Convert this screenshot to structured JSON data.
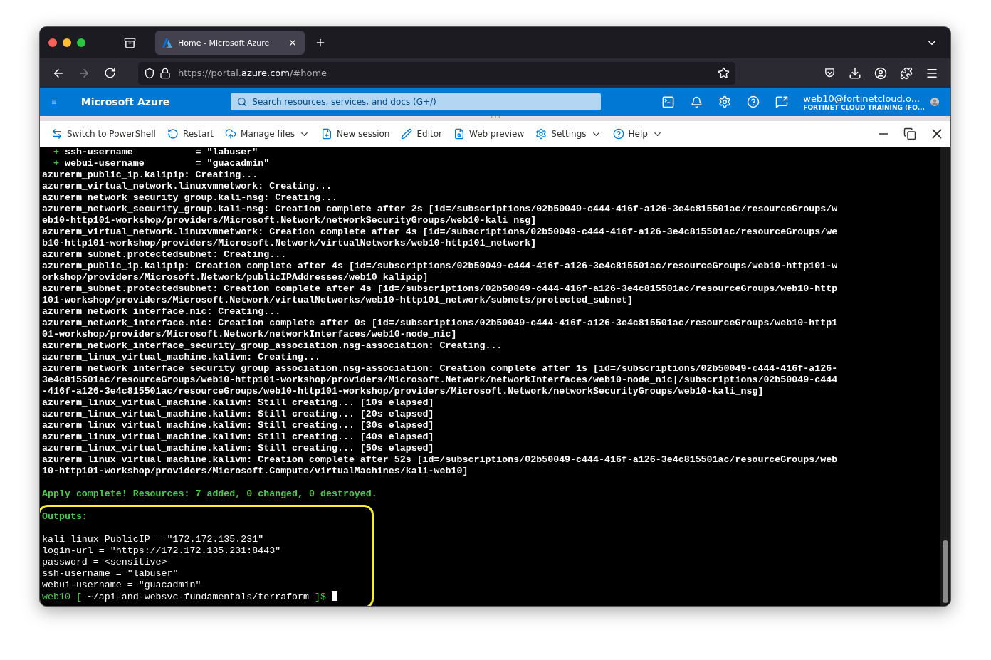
{
  "browser": {
    "tabs": [
      {
        "title": "Home - Microsoft Azure",
        "selected": true
      }
    ],
    "nav": {
      "back_disabled": false,
      "forward_disabled": true
    },
    "url": {
      "prefix": "https://portal.",
      "domain": "azure.com",
      "suffix": "/#home"
    }
  },
  "portal": {
    "brand": "Microsoft Azure",
    "search_placeholder": "Search resources, services, and docs (G+/)",
    "account": {
      "email": "web10@fortinetcloud.o...",
      "tenant": "FORTINET CLOUD TRAINING (FO..."
    }
  },
  "shell_toolbar": {
    "items": [
      {
        "kind": "switch",
        "label": "Switch to PowerShell",
        "dropdown": false
      },
      {
        "kind": "restart",
        "label": "Restart",
        "dropdown": false
      },
      {
        "kind": "files",
        "label": "Manage files",
        "dropdown": true
      },
      {
        "kind": "session",
        "label": "New session",
        "dropdown": false
      },
      {
        "kind": "editor",
        "label": "Editor",
        "dropdown": false
      },
      {
        "kind": "preview",
        "label": "Web preview",
        "dropdown": false
      },
      {
        "kind": "settings",
        "label": "Settings",
        "dropdown": true
      },
      {
        "kind": "help",
        "label": "Help",
        "dropdown": true
      }
    ]
  },
  "terminal": {
    "lines": [
      {
        "kind": "added",
        "sign": "+",
        "text": "ssh-username           = \"labuser\""
      },
      {
        "kind": "added",
        "sign": "+",
        "text": "webui-username         = \"guacadmin\""
      },
      {
        "kind": "log",
        "text": "azurerm_public_ip.kalipip: Creating..."
      },
      {
        "kind": "log",
        "text": "azurerm_virtual_network.linuxvmnetwork: Creating..."
      },
      {
        "kind": "log",
        "text": "azurerm_network_security_group.kali-nsg: Creating..."
      },
      {
        "kind": "log",
        "text": "azurerm_network_security_group.kali-nsg: Creation complete after 2s [id=/subscriptions/02b50049-c444-416f-a126-3e4c815501ac/resourceGroups/w"
      },
      {
        "kind": "log",
        "text": "eb10-http101-workshop/providers/Microsoft.Network/networkSecurityGroups/web10-kali_nsg]"
      },
      {
        "kind": "log",
        "text": "azurerm_virtual_network.linuxvmnetwork: Creation complete after 4s [id=/subscriptions/02b50049-c444-416f-a126-3e4c815501ac/resourceGroups/we"
      },
      {
        "kind": "log",
        "text": "b10-http101-workshop/providers/Microsoft.Network/virtualNetworks/web10-http101_network]"
      },
      {
        "kind": "log",
        "text": "azurerm_subnet.protectedsubnet: Creating..."
      },
      {
        "kind": "log",
        "text": "azurerm_public_ip.kalipip: Creation complete after 4s [id=/subscriptions/02b50049-c444-416f-a126-3e4c815501ac/resourceGroups/web10-http101-w"
      },
      {
        "kind": "log",
        "text": "orkshop/providers/Microsoft.Network/publicIPAddresses/web10_kalipip]"
      },
      {
        "kind": "log",
        "text": "azurerm_subnet.protectedsubnet: Creation complete after 4s [id=/subscriptions/02b50049-c444-416f-a126-3e4c815501ac/resourceGroups/web10-http"
      },
      {
        "kind": "log",
        "text": "101-workshop/providers/Microsoft.Network/virtualNetworks/web10-http101_network/subnets/protected_subnet]"
      },
      {
        "kind": "log",
        "text": "azurerm_network_interface.nic: Creating..."
      },
      {
        "kind": "log",
        "text": "azurerm_network_interface.nic: Creation complete after 0s [id=/subscriptions/02b50049-c444-416f-a126-3e4c815501ac/resourceGroups/web10-http1"
      },
      {
        "kind": "log",
        "text": "01-workshop/providers/Microsoft.Network/networkInterfaces/web10-node_nic]"
      },
      {
        "kind": "log",
        "text": "azurerm_network_interface_security_group_association.nsg-association: Creating..."
      },
      {
        "kind": "log",
        "text": "azurerm_linux_virtual_machine.kalivm: Creating..."
      },
      {
        "kind": "log",
        "text": "azurerm_network_interface_security_group_association.nsg-association: Creation complete after 1s [id=/subscriptions/02b50049-c444-416f-a126-"
      },
      {
        "kind": "log",
        "text": "3e4c815501ac/resourceGroups/web10-http101-workshop/providers/Microsoft.Network/networkInterfaces/web10-node_nic|/subscriptions/02b50049-c444"
      },
      {
        "kind": "log",
        "text": "-416f-a126-3e4c815501ac/resourceGroups/web10-http101-workshop/providers/Microsoft.Network/networkSecurityGroups/web10-kali_nsg]"
      },
      {
        "kind": "log",
        "text": "azurerm_linux_virtual_machine.kalivm: Still creating... [10s elapsed]"
      },
      {
        "kind": "log",
        "text": "azurerm_linux_virtual_machine.kalivm: Still creating... [20s elapsed]"
      },
      {
        "kind": "log",
        "text": "azurerm_linux_virtual_machine.kalivm: Still creating... [30s elapsed]"
      },
      {
        "kind": "log",
        "text": "azurerm_linux_virtual_machine.kalivm: Still creating... [40s elapsed]"
      },
      {
        "kind": "log",
        "text": "azurerm_linux_virtual_machine.kalivm: Still creating... [50s elapsed]"
      },
      {
        "kind": "log",
        "text": "azurerm_linux_virtual_machine.kalivm: Creation complete after 52s [id=/subscriptions/02b50049-c444-416f-a126-3e4c815501ac/resourceGroups/web"
      },
      {
        "kind": "log",
        "text": "10-http101-workshop/providers/Microsoft.Compute/virtualMachines/kali-web10]"
      },
      {
        "kind": "blank"
      },
      {
        "kind": "success",
        "text": "Apply complete! Resources: 7 added, 0 changed, 0 destroyed."
      },
      {
        "kind": "blank"
      },
      {
        "kind": "success",
        "text": "Outputs:"
      },
      {
        "kind": "blank"
      },
      {
        "kind": "output",
        "text": "kali_linux_PublicIP = \"172.172.135.231\""
      },
      {
        "kind": "output",
        "text": "login-url = \"https://172.172.135.231:8443\""
      },
      {
        "kind": "output",
        "text": "password = <sensitive>"
      },
      {
        "kind": "output",
        "text": "ssh-username = \"labuser\""
      },
      {
        "kind": "output",
        "text": "webui-username = \"guacadmin\""
      },
      {
        "kind": "prompt",
        "user": "web10",
        "open": "[",
        "path": "~/api-and-websvc-fundamentals/terraform",
        "close": "]$"
      }
    ]
  }
}
